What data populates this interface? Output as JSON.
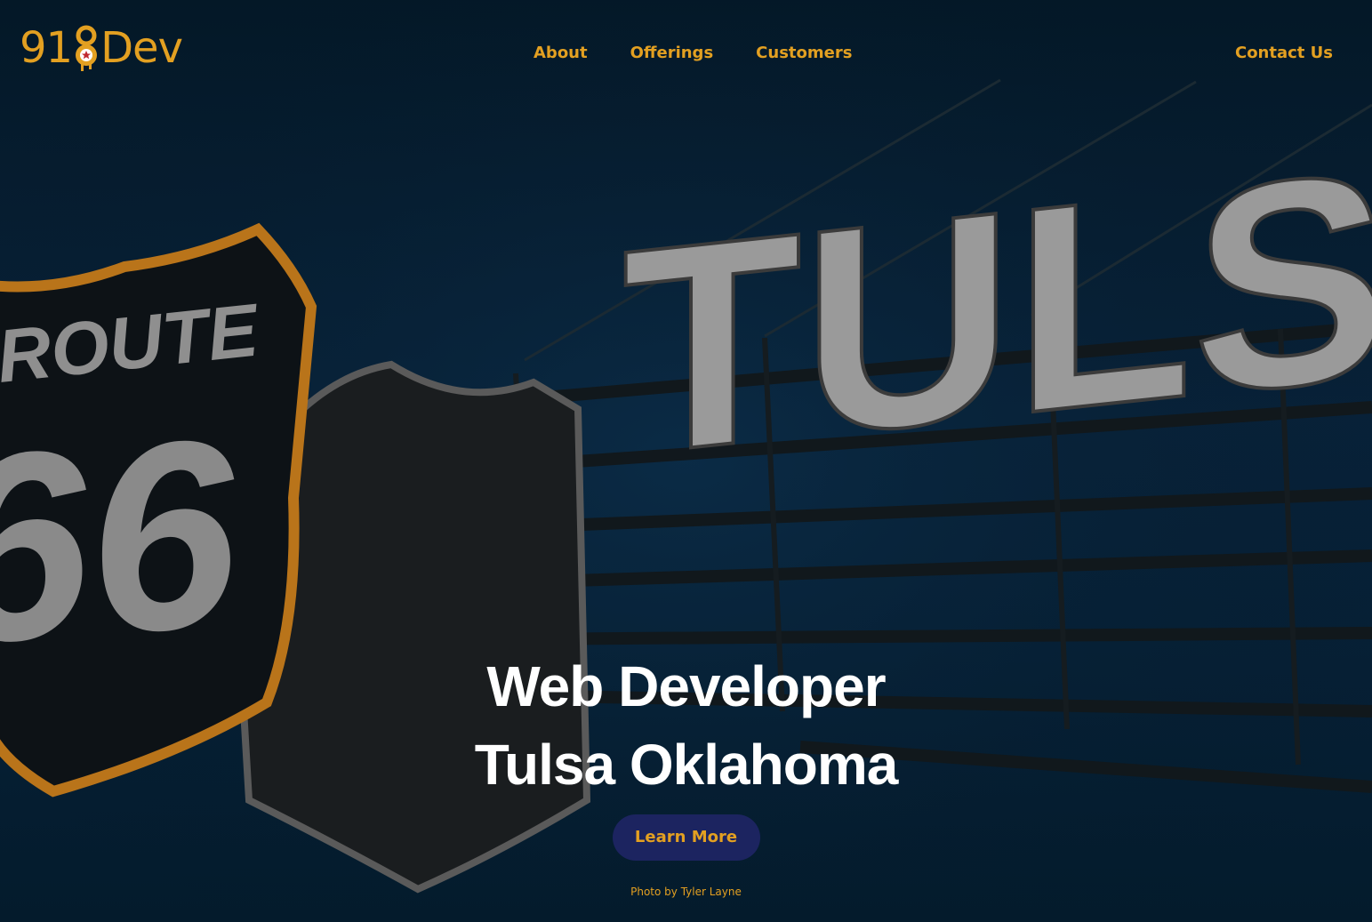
{
  "brand": {
    "logo_text_left": "91",
    "logo_text_right": "Dev",
    "color_accent": "#e3a021"
  },
  "nav": {
    "items": [
      {
        "label": "About"
      },
      {
        "label": "Offerings"
      },
      {
        "label": "Customers"
      }
    ],
    "contact_label": "Contact Us"
  },
  "hero": {
    "title_line1": "Web Developer",
    "title_line2": "Tulsa Oklahoma",
    "button_label": "Learn More",
    "button_color": "#1c2460"
  },
  "credit": {
    "text": "Photo by Tyler Layne"
  },
  "background_image": {
    "sign_route_text": "ROUTE",
    "sign_number": "66",
    "sign_city": "TULSA"
  }
}
